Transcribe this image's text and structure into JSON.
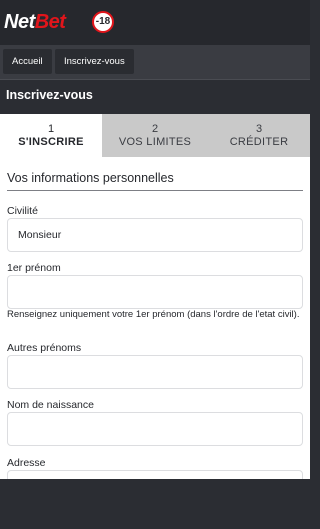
{
  "brand": {
    "logo_part1": "Net",
    "logo_part2": "Bet",
    "age_badge": "-18",
    "brand_red": "#e1151b"
  },
  "breadcrumb": {
    "items": [
      {
        "label": "Accueil"
      },
      {
        "label": "Inscrivez-vous"
      }
    ]
  },
  "page": {
    "title": "Inscrivez-vous"
  },
  "steps": [
    {
      "number": "1",
      "label": "S'INSCRIRE",
      "active": true
    },
    {
      "number": "2",
      "label": "VOS LIMITES",
      "active": false
    },
    {
      "number": "3",
      "label": "CRÉDITER",
      "active": false
    }
  ],
  "form": {
    "section_title": "Vos informations personnelles",
    "civilite": {
      "label": "Civilité",
      "value": "Monsieur"
    },
    "first_name": {
      "label": "1er prénom",
      "value": "",
      "hint": "Renseignez uniquement votre 1er prénom (dans l'ordre de l'etat civil)."
    },
    "other_names": {
      "label": "Autres prénoms",
      "value": ""
    },
    "last_name": {
      "label": "Nom de naissance",
      "value": ""
    },
    "address": {
      "label": "Adresse",
      "value": ""
    }
  }
}
